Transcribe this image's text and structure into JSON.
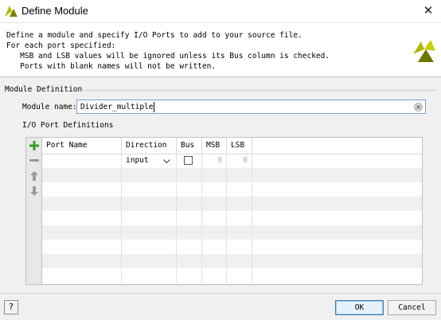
{
  "window": {
    "title": "Define Module",
    "close_glyph": "✕"
  },
  "header": {
    "lines": [
      "Define a module and specify I/O Ports to add to your source file.",
      "For each port specified:",
      "   MSB and LSB values will be ignored unless its Bus column is checked.",
      "   Ports with blank names will not be written."
    ],
    "logo_icon": "vivado-logo-icon"
  },
  "module_definition": {
    "section_label": "Module Definition",
    "name_label": "Module name:",
    "name_value": "Divider_multiple"
  },
  "io_ports": {
    "section_label": "I/O Port Definitions",
    "columns": [
      "Port Name",
      "Direction",
      "Bus",
      "MSB",
      "LSB"
    ],
    "rows": [
      {
        "port_name": "",
        "direction": "input",
        "bus": false,
        "msb": "0",
        "lsb": "0"
      }
    ],
    "toolbar": [
      "add-icon",
      "remove-icon",
      "move-up-icon",
      "move-down-icon"
    ]
  },
  "footer": {
    "help_label": "?",
    "ok_label": "OK",
    "cancel_label": "Cancel"
  },
  "colors": {
    "add_green": "#3a9a2c",
    "ok_border": "#3c7fb1",
    "logo_yellow": "#b5b800",
    "logo_dark": "#6f7500"
  }
}
